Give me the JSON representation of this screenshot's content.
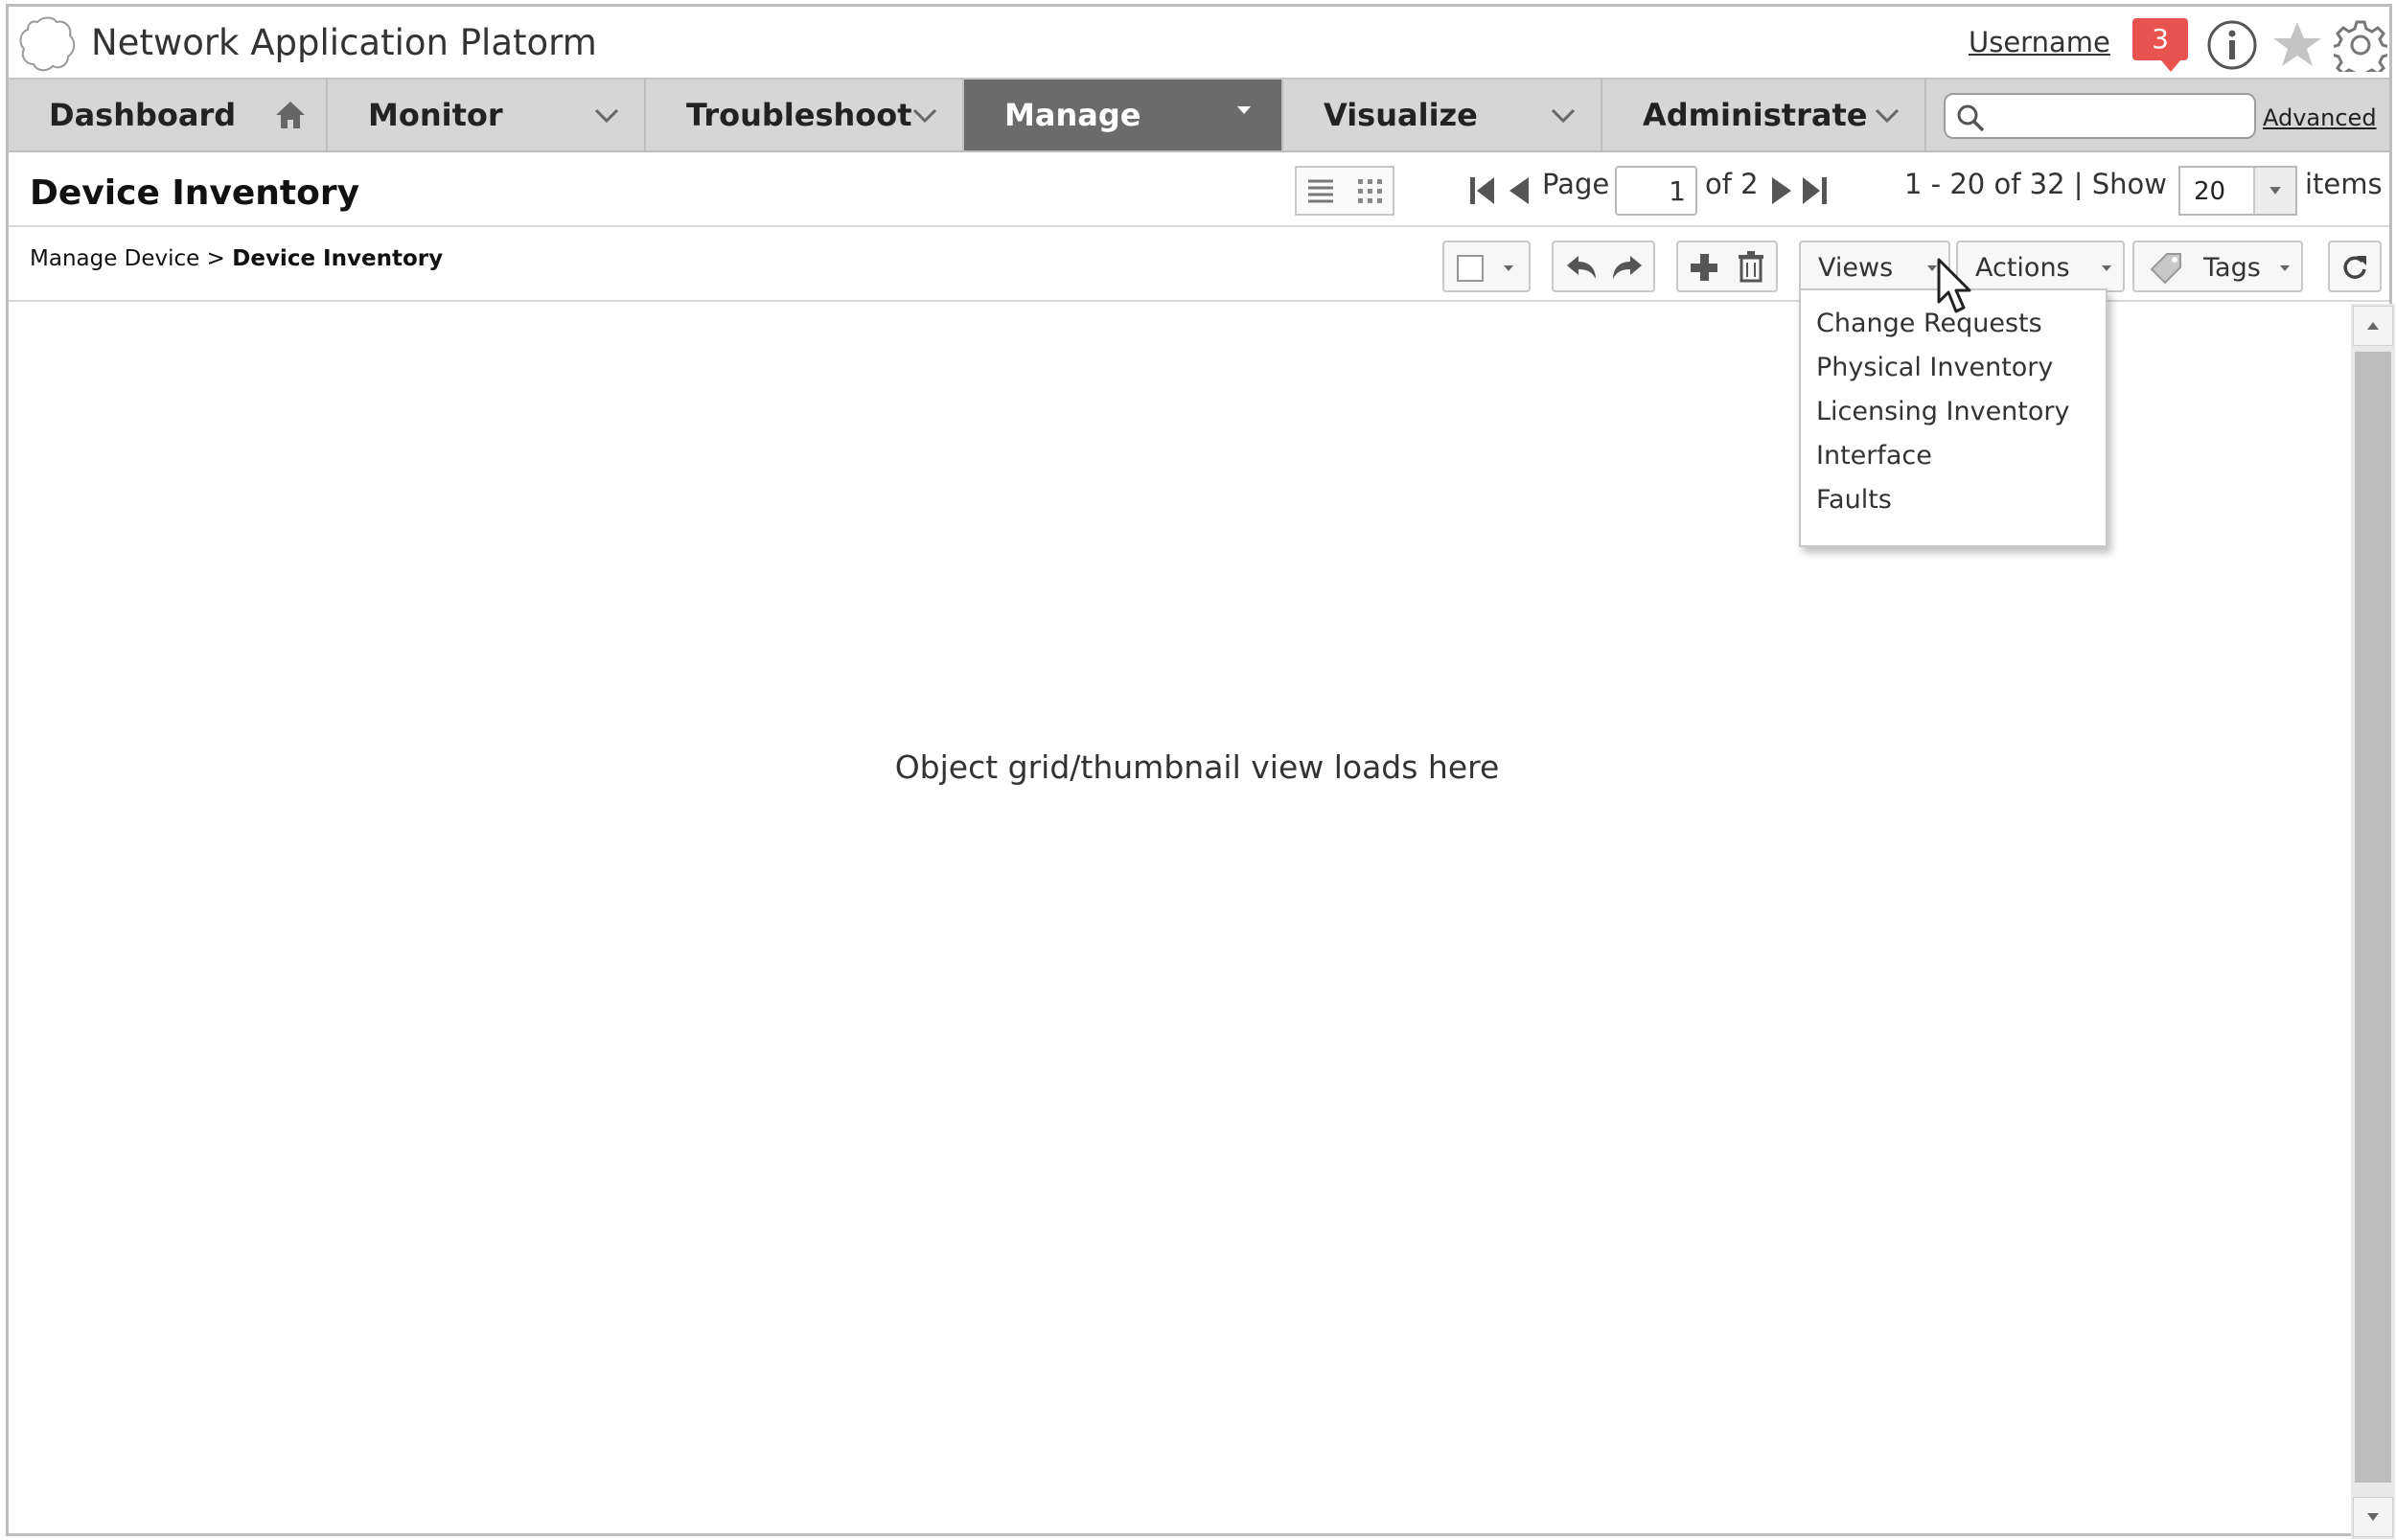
{
  "header": {
    "app_title": "Network Application Platorm",
    "username": "Username",
    "notification_count": "3"
  },
  "nav": {
    "items": [
      {
        "label": "Dashboard",
        "icon": "home-icon"
      },
      {
        "label": "Monitor",
        "icon": "chevron-down-icon"
      },
      {
        "label": "Troubleshoot",
        "icon": "chevron-down-icon"
      },
      {
        "label": "Manage",
        "icon": "caret-down-icon",
        "active": true
      },
      {
        "label": "Visualize",
        "icon": "chevron-down-icon"
      },
      {
        "label": "Administrate",
        "icon": "chevron-down-icon"
      }
    ],
    "search_placeholder": "",
    "advanced_label": "Advanced"
  },
  "titlebar": {
    "title": "Device Inventory",
    "page_label": "Page",
    "page_value": "1",
    "of_label": "of 2",
    "range_label": "1 - 20 of 32 | Show",
    "show_value": "20",
    "items_label": "items"
  },
  "toolbar": {
    "breadcrumb_parent": "Manage Device",
    "breadcrumb_sep": ">",
    "breadcrumb_current": "Device Inventory",
    "views_label": "Views",
    "actions_label": "Actions",
    "tags_label": "Tags"
  },
  "views_menu": {
    "items": [
      "Change Requests",
      "Physical Inventory",
      "Licensing Inventory",
      "Interface",
      "Faults"
    ]
  },
  "content": {
    "placeholder": "Object grid/thumbnail view loads here"
  },
  "colors": {
    "nav_bg": "#d6d6d6",
    "nav_active_bg": "#6b6b6b",
    "notification_badge": "#e8534f"
  }
}
